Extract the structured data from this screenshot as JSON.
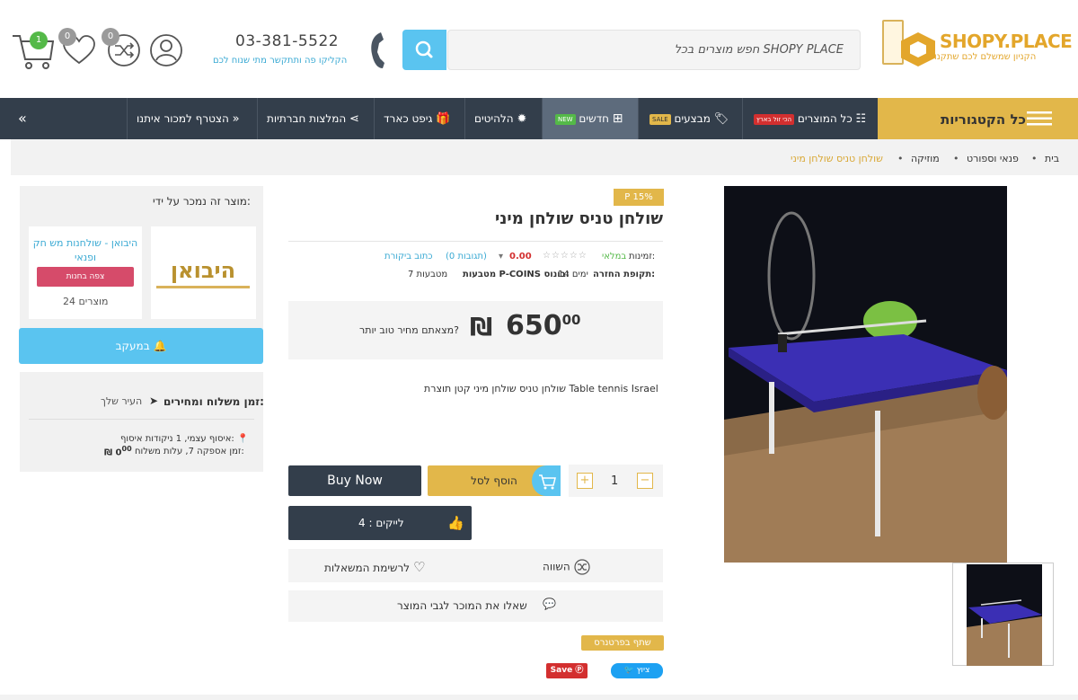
{
  "header": {
    "logo_title": "SHOPY.PLACE",
    "logo_tagline": "הקניון שמשלם לכם שתקנו",
    "search_placeholder": "חפש מוצרים בכל SHOPY PLACE",
    "phone_number": "03-381-5522",
    "phone_sub": "הקליקו פה ותתקשר מתי שנוח לכם",
    "cart_count": "1",
    "wishlist_count": "0",
    "compare_count": "0"
  },
  "nav": {
    "all_categories": "כל הקטגוריות",
    "items": [
      {
        "label": "כל המוצרים",
        "badge": "הכי זול בארץ"
      },
      {
        "label": "מבצעים",
        "badge": "SALE"
      },
      {
        "label": "חדשים",
        "badge": "NEW"
      },
      {
        "label": "הלהיטים"
      },
      {
        "label": "גיפט כארד"
      },
      {
        "label": "המלצות חברתיות"
      },
      {
        "label": "הצטרף למכור איתנו"
      }
    ]
  },
  "breadcrumb": [
    "בית",
    "פנאי וספורט",
    "מוזיקה",
    "שולחן טניס שולחן מיני"
  ],
  "product": {
    "discount": "P 15%",
    "title": "שולחן טניס שולחן מיני",
    "availability_label": "זמינות:",
    "availability_value": "במלאי",
    "rating": "0.00",
    "reviews_count": "(0 תגובות)",
    "write_review": "כתוב ביקורת",
    "return_label": "תקופת החזרה:",
    "return_value": "14 ימים",
    "coins_label": "מטבעות P-COINS בונוס:",
    "coins_value": "7 מטבעות",
    "price_main": "650",
    "price_cents": "00",
    "currency": "₪",
    "better_price": "מצאתם מחיר טוב יותר?",
    "description": "שולחן טניס שולחן מיני קטן תוצרת Table tennis Israel",
    "quantity": "1",
    "add_to_cart": "הוסף לסל",
    "buy_now": "Buy Now",
    "likes": "לייקים : 4",
    "compare": "השווה",
    "wishlist": "לרשימת המשאלות",
    "ask_seller": "שאלו את המוכר לגבי המוצר",
    "partner": "שתף בפרטנרס",
    "tweet": "ציוץ",
    "save": "Save"
  },
  "seller": {
    "title": "מוצר זה נמכר על ידי:",
    "logo_text": "היבואן",
    "name": "היבואן - שולחנות מש חק ופנאי",
    "view_store": "צפה בחנות",
    "products_count": "24 מוצרים",
    "tracking": "במעקב"
  },
  "shipping": {
    "title": "זמן משלוח ומחירים:",
    "city": "העיר שלך",
    "pickup": "איסוף עצמי, 1 ניקודות איסוף:",
    "delivery": "זמן אספקה 7, עלות משלוח:",
    "delivery_price": "0",
    "delivery_cents": "00",
    "currency": "₪"
  }
}
